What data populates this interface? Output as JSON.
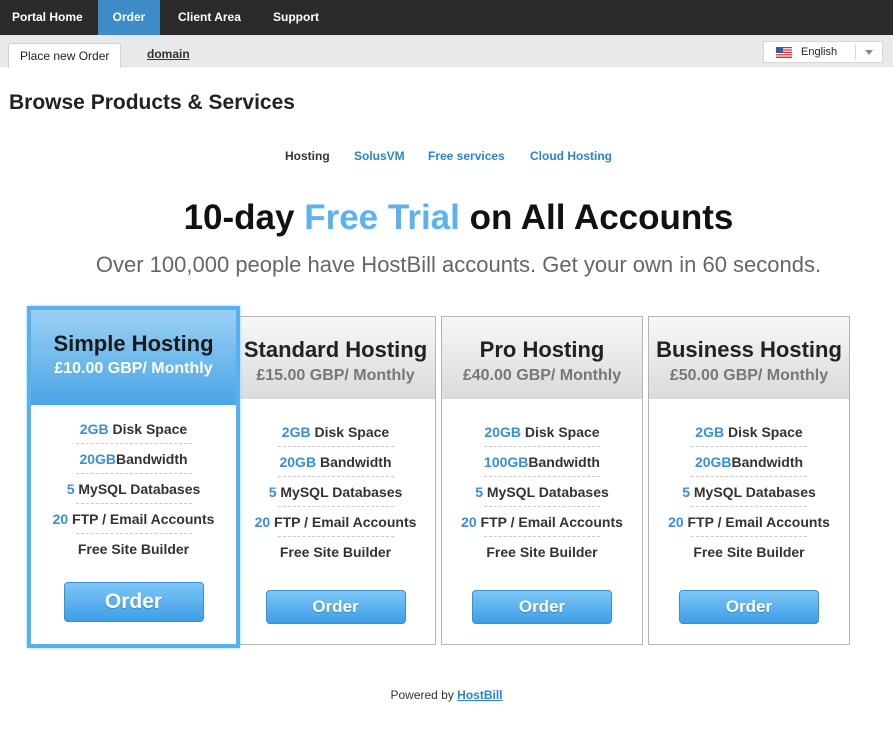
{
  "nav": {
    "items": [
      {
        "label": "Portal Home"
      },
      {
        "label": "Order"
      },
      {
        "label": "Client Area"
      },
      {
        "label": "Support"
      }
    ]
  },
  "subnav": {
    "tab": "Place new Order",
    "link": "domain"
  },
  "language": {
    "selected": "English",
    "icon": "us-flag-icon"
  },
  "page_title": "Browse Products & Services",
  "categories": {
    "current": "Hosting",
    "links": [
      "SolusVM",
      "Free services",
      "Cloud Hosting"
    ]
  },
  "promo": {
    "pre": "10-day ",
    "highlight": "Free Trial",
    "post": " on All Accounts",
    "subtitle": "Over 100,000 people have HostBill accounts. Get your own in 60 seconds."
  },
  "plans": [
    {
      "name": "Simple Hosting",
      "price": "£10.00 GBP/ Monthly",
      "features": [
        {
          "num": "2GB",
          "text": " Disk Space"
        },
        {
          "num": "20GB",
          "text": "Bandwidth"
        },
        {
          "num": "5",
          "text": " MySQL Databases"
        },
        {
          "num": "20",
          "text": " FTP / Email Accounts"
        },
        {
          "num": "",
          "text": "Free Site Builder"
        }
      ],
      "button": "Order"
    },
    {
      "name": "Standard Hosting",
      "price": "£15.00 GBP/ Monthly",
      "features": [
        {
          "num": "2GB",
          "text": " Disk Space"
        },
        {
          "num": "20GB",
          "text": " Bandwidth"
        },
        {
          "num": "5",
          "text": " MySQL Databases"
        },
        {
          "num": "20",
          "text": " FTP / Email Accounts"
        },
        {
          "num": "",
          "text": "Free Site Builder"
        }
      ],
      "button": "Order"
    },
    {
      "name": "Pro Hosting",
      "price": "£40.00 GBP/ Monthly",
      "features": [
        {
          "num": "20GB",
          "text": " Disk Space"
        },
        {
          "num": "100GB",
          "text": "Bandwidth"
        },
        {
          "num": "5",
          "text": " MySQL Databases"
        },
        {
          "num": "20",
          "text": " FTP / Email Accounts"
        },
        {
          "num": "",
          "text": "Free Site Builder"
        }
      ],
      "button": "Order"
    },
    {
      "name": "Business Hosting",
      "price": "£50.00 GBP/ Monthly",
      "features": [
        {
          "num": "2GB",
          "text": " Disk Space"
        },
        {
          "num": "20GB",
          "text": "Bandwidth"
        },
        {
          "num": "5",
          "text": " MySQL Databases"
        },
        {
          "num": "20",
          "text": " FTP / Email Accounts"
        },
        {
          "num": "",
          "text": "Free Site Builder"
        }
      ],
      "button": "Order"
    }
  ],
  "footer": {
    "text": "Powered by ",
    "link": "HostBill"
  },
  "colors": {
    "accent": "#3d8bc7",
    "highlight": "#5ab2ee",
    "nav_bg": "#2b2b2b"
  }
}
